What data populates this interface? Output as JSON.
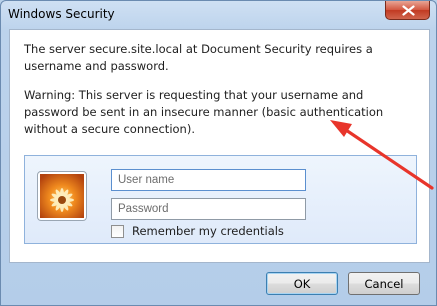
{
  "window": {
    "title": "Windows Security",
    "close_icon": "close-icon"
  },
  "message": {
    "primary": "The server secure.site.local at Document Security requires a username and password.",
    "warning": "Warning: This server is requesting that your username and password be sent in an insecure manner (basic authentication without a secure connection)."
  },
  "credentials": {
    "avatar_icon": "user-tile-icon",
    "username": {
      "value": "",
      "placeholder": "User name"
    },
    "password": {
      "value": "",
      "placeholder": "Password"
    },
    "remember": {
      "label": "Remember my credentials",
      "checked": false
    }
  },
  "buttons": {
    "ok": "OK",
    "cancel": "Cancel"
  },
  "annotation": {
    "arrow_color": "#e8352b",
    "icon": "red-arrow-annotation"
  }
}
